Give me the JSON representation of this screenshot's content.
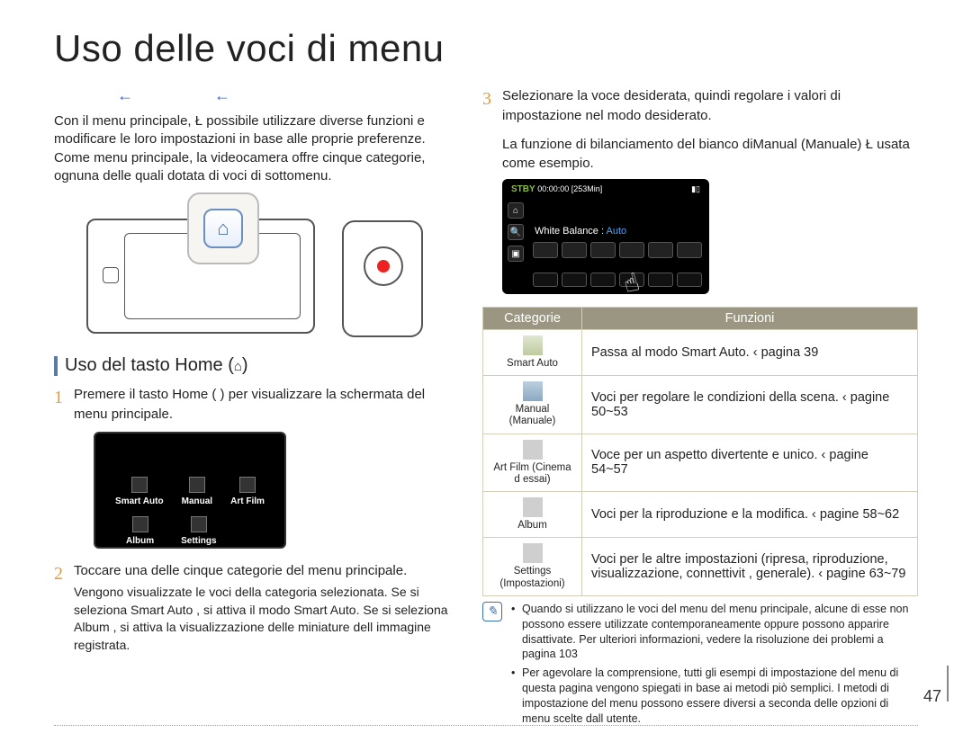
{
  "title": "Uso delle voci di menu",
  "arrows": {
    "a1": "←",
    "a2": "←"
  },
  "intro": "Con il menu principale, Ł possibile utilizzare diverse funzioni e modificare le loro impostazioni in base alle proprie preferenze. Come menu principale, la videocamera offre cinque categorie, ognuna delle quali dotata di voci di sottomenu.",
  "section_home": {
    "title": "Uso del tasto Home (",
    "icon_suffix": ")"
  },
  "steps": {
    "s1": "Premere il tasto Home ( ) per visualizzare la schermata del menu principale.",
    "mini_items": [
      "Smart Auto",
      "Manual",
      "Art Film",
      "Album",
      "Settings"
    ],
    "s2": "Toccare una delle cinque categorie del menu principale.",
    "s2_sub": "Vengono visualizzate le voci della categoria selezionata. Se si seleziona Smart Auto , si attiva il modo Smart Auto. Se si seleziona Album , si attiva la visualizzazione delle miniature dell immagine registrata.",
    "s3": "Selezionare la voce desiderata, quindi regolare i valori di impostazione nel modo desiderato.",
    "s3_sub": "La funzione di bilanciamento del bianco diManual (Manuale) Ł usata come esempio."
  },
  "wb_shot": {
    "stby": "STBY",
    "time": "00:00:00",
    "remain": "[253Min]",
    "label_prefix": "White Balance : ",
    "label_value": "Auto"
  },
  "table": {
    "head_cat": "Categorie",
    "head_fun": "Funzioni",
    "rows": [
      {
        "cat": "Smart Auto",
        "fun": "Passa al modo Smart Auto. ‹ pagina 39"
      },
      {
        "cat": "Manual (Manuale)",
        "fun": "Voci per regolare le condizioni della scena. ‹ pagine 50~53"
      },
      {
        "cat": "Art Film (Cinema d essai)",
        "fun": "Voce per un aspetto divertente e unico. ‹ pagine 54~57"
      },
      {
        "cat": "Album",
        "fun": "Voci per la riproduzione e la modifica. ‹ pagine 58~62"
      },
      {
        "cat": "Settings (Impostazioni)",
        "fun": "Voci per le altre impostazioni (ripresa, riproduzione, visualizzazione, connettivit , generale). ‹ pagine 63~79"
      }
    ]
  },
  "notes": [
    "Quando si utilizzano le voci del menu del menu principale, alcune di esse non possono essere utilizzate contemporaneamente oppure possono apparire disattivate. Per ulteriori informazioni, vedere la risoluzione dei problemi a pagina 103",
    "Per agevolare la comprensione, tutti gli esempi di impostazione del menu di questa pagina vengono spiegati in base ai metodi piò semplici. I metodi di impostazione del menu possono essere diversi a seconda delle opzioni di menu scelte dall utente."
  ],
  "page_number": "47"
}
